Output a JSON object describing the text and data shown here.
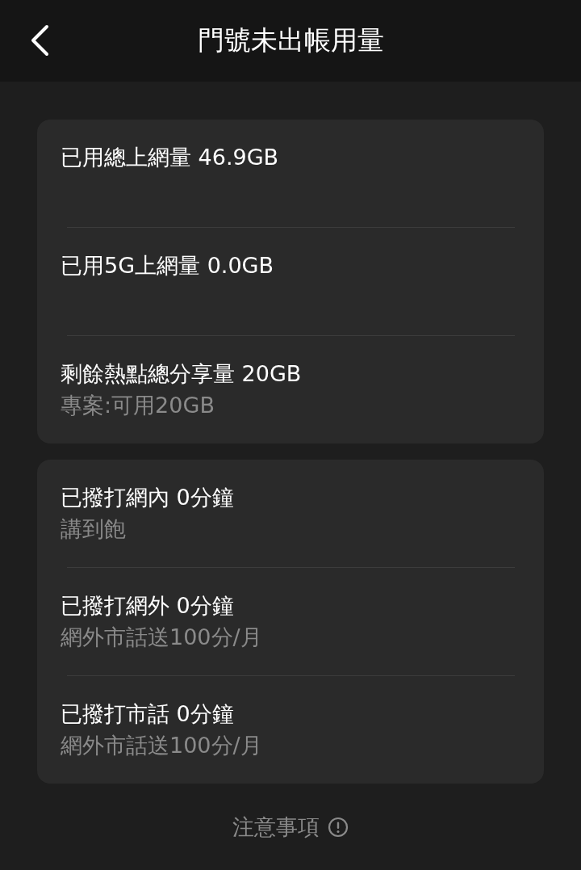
{
  "header": {
    "title": "門號未出帳用量"
  },
  "cards": [
    {
      "rows": [
        {
          "title": "已用總上網量 46.9GB"
        },
        {
          "title": "已用5G上網量 0.0GB"
        },
        {
          "title": "剩餘熱點總分享量 20GB",
          "subtitle": "專案:可用20GB"
        }
      ]
    },
    {
      "rows": [
        {
          "title": "已撥打網內 0分鐘",
          "subtitle": "講到飽"
        },
        {
          "title": "已撥打網外 0分鐘",
          "subtitle": "網外市話送100分/月"
        },
        {
          "title": "已撥打市話 0分鐘",
          "subtitle": "網外市話送100分/月"
        }
      ]
    }
  ],
  "footer": {
    "label": "注意事項"
  }
}
